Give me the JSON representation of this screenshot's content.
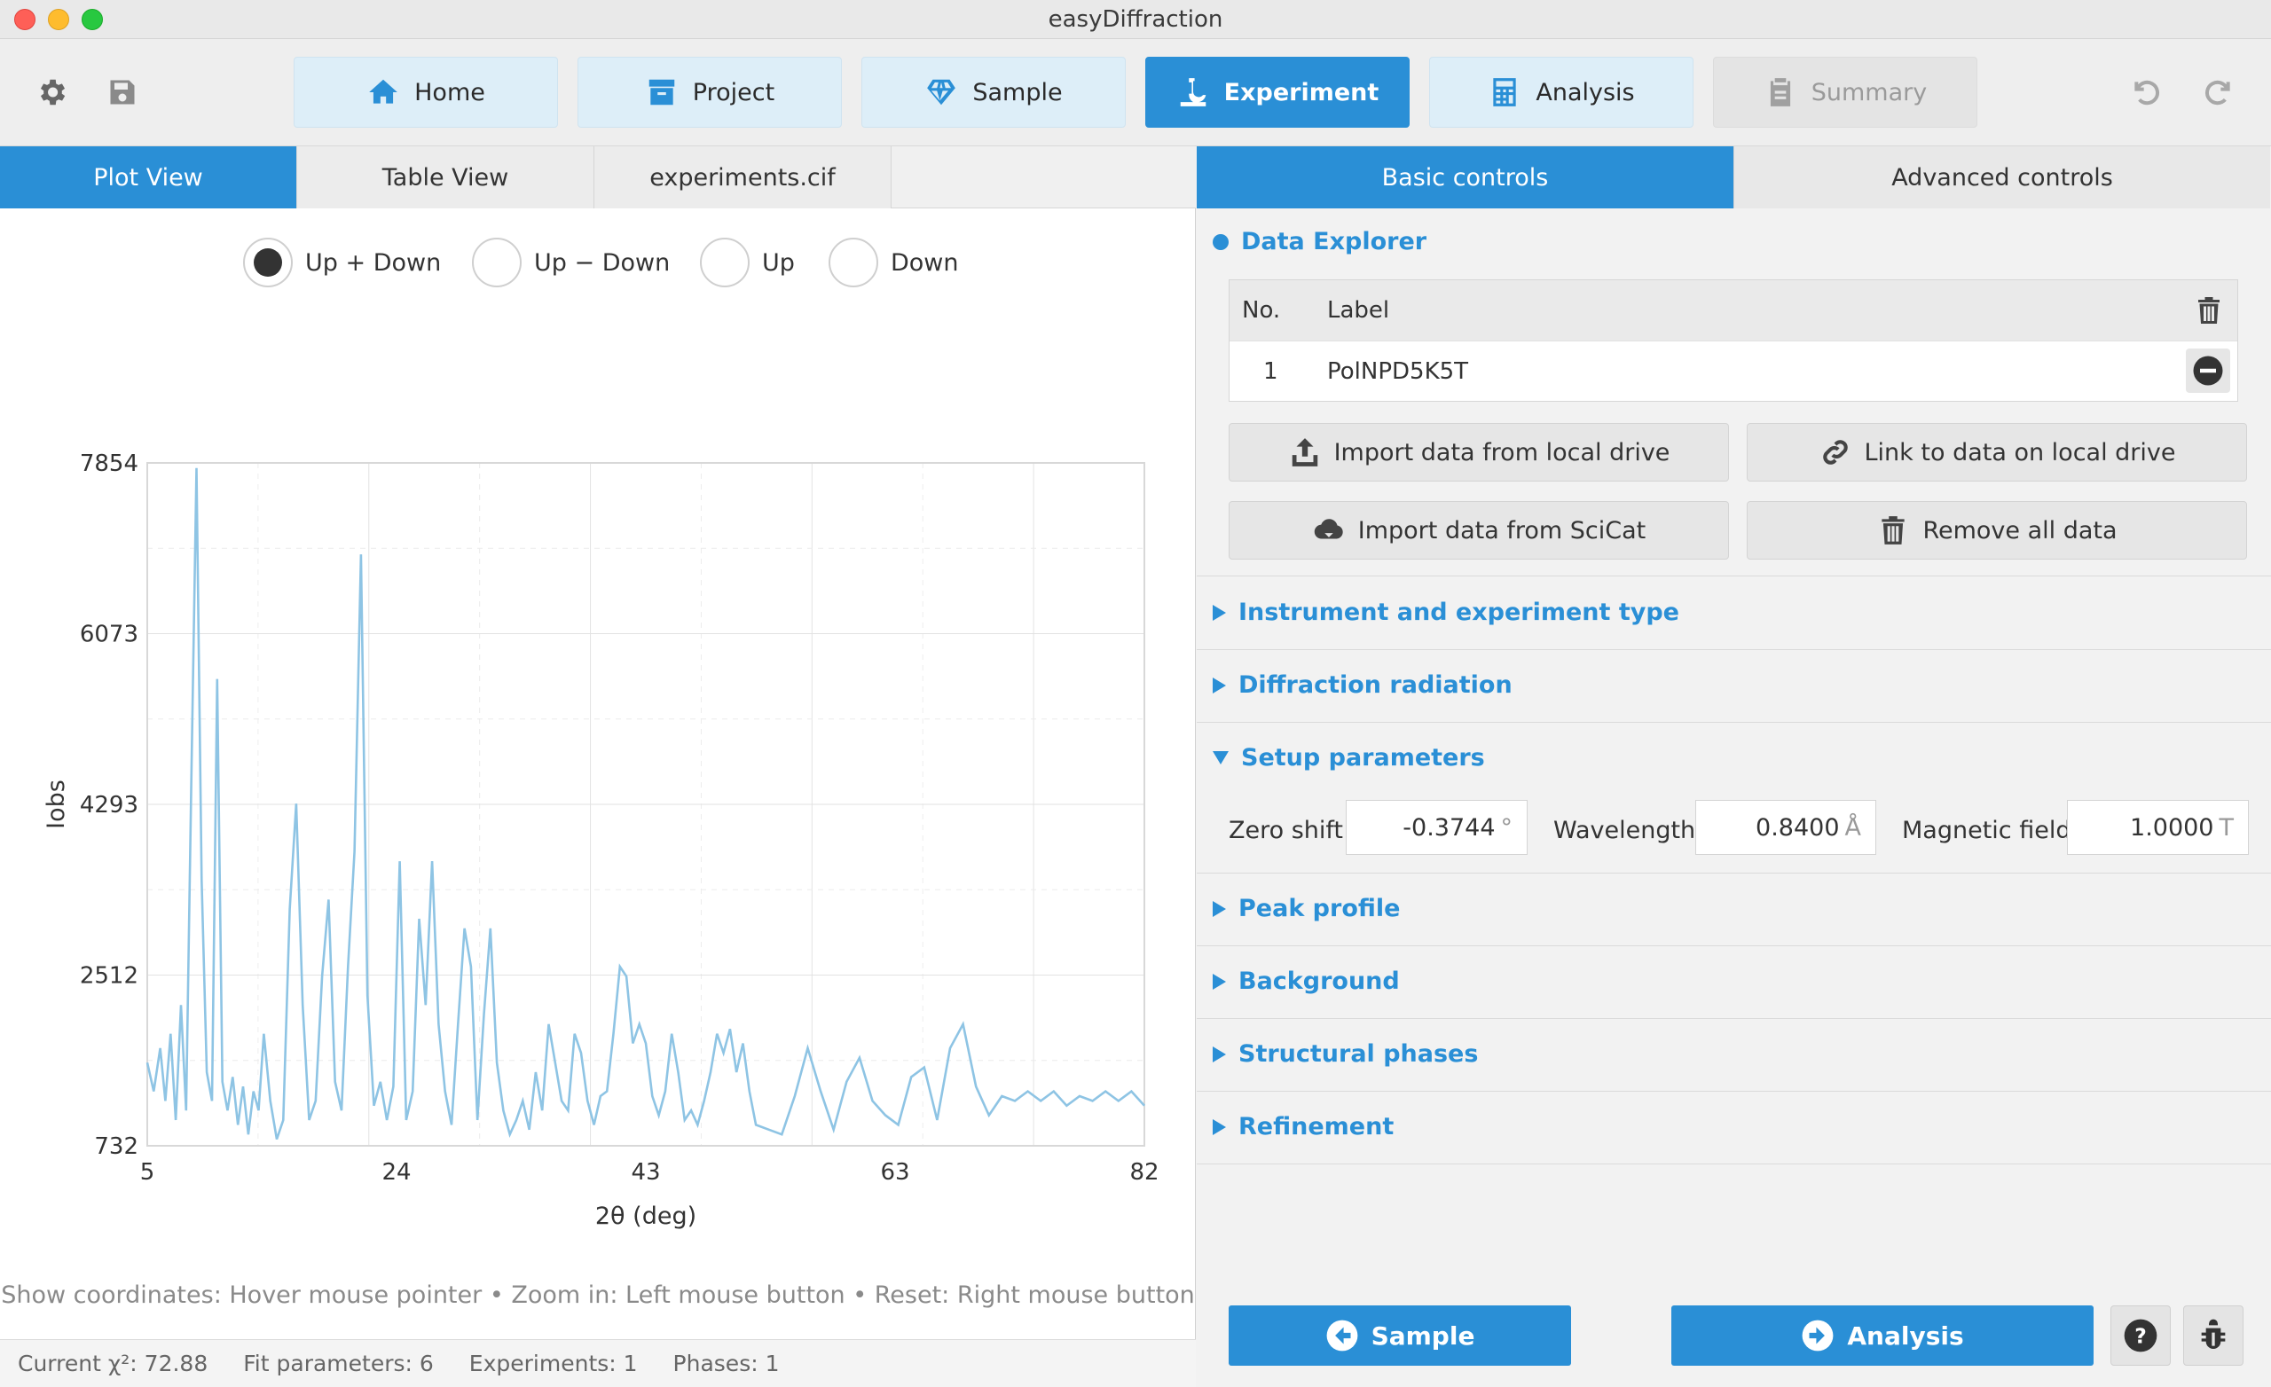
{
  "window": {
    "title": "easyDiffraction"
  },
  "toolbar": {
    "tabs": [
      {
        "label": "Home",
        "icon": "home-icon"
      },
      {
        "label": "Project",
        "icon": "archive-icon"
      },
      {
        "label": "Sample",
        "icon": "gem-icon"
      },
      {
        "label": "Experiment",
        "icon": "microscope-icon"
      },
      {
        "label": "Analysis",
        "icon": "calculator-icon"
      },
      {
        "label": "Summary",
        "icon": "clipboard-icon"
      }
    ],
    "active_tab": "Experiment"
  },
  "left": {
    "subtabs": [
      "Plot View",
      "Table View",
      "experiments.cif"
    ],
    "radios": [
      {
        "label": "Up + Down",
        "checked": true
      },
      {
        "label": "Up − Down",
        "checked": false
      },
      {
        "label": "Up",
        "checked": false
      },
      {
        "label": "Down",
        "checked": false
      }
    ],
    "hint": "Show coordinates: Hover mouse pointer  •  Zoom in: Left mouse button  •  Reset: Right mouse button",
    "status": {
      "chi": "Current χ²: 72.88",
      "fit": "Fit parameters: 6",
      "experiments": "Experiments: 1",
      "phases": "Phases: 1"
    }
  },
  "chart_data": {
    "type": "line",
    "title": "",
    "xlabel": "2θ (deg)",
    "ylabel": "Iobs",
    "xlim": [
      5,
      82
    ],
    "ylim": [
      732,
      7854
    ],
    "x_ticks": [
      "5",
      "24",
      "43",
      "63",
      "82"
    ],
    "y_ticks": [
      "7854",
      "6073",
      "4293",
      "2512",
      "732"
    ],
    "series": [
      {
        "color": "#8ec4e4",
        "x": [
          5.0,
          5.5,
          6.0,
          6.4,
          6.8,
          7.2,
          7.6,
          8.0,
          8.4,
          8.8,
          9.2,
          9.6,
          10.0,
          10.4,
          10.8,
          11.2,
          11.6,
          12.0,
          12.4,
          12.8,
          13.2,
          13.6,
          14.0,
          14.5,
          15.0,
          15.5,
          16.0,
          16.5,
          17.0,
          17.5,
          18.0,
          18.5,
          19.0,
          19.5,
          20.0,
          20.5,
          21.0,
          21.5,
          22.0,
          22.5,
          23.0,
          23.5,
          24.0,
          24.5,
          25.0,
          25.5,
          26.0,
          26.5,
          27.0,
          27.5,
          28.0,
          28.5,
          29.0,
          29.5,
          30.0,
          30.5,
          31.0,
          31.5,
          32.0,
          32.5,
          33.0,
          33.5,
          34.0,
          34.5,
          35.0,
          35.5,
          36.0,
          36.5,
          37.0,
          37.5,
          38.0,
          38.5,
          39.0,
          39.5,
          40.0,
          40.5,
          41.0,
          41.5,
          42.0,
          42.5,
          43.0,
          43.5,
          44.0,
          44.5,
          45.0,
          45.5,
          46.0,
          46.5,
          47.0,
          47.5,
          48.0,
          48.5,
          49.0,
          49.5,
          50.0,
          50.5,
          51.0,
          51.5,
          52.0,
          53.0,
          54.0,
          55.0,
          56.0,
          57.0,
          58.0,
          59.0,
          60.0,
          61.0,
          62.0,
          63.0,
          64.0,
          65.0,
          66.0,
          67.0,
          68.0,
          69.0,
          70.0,
          71.0,
          72.0,
          73.0,
          74.0,
          75.0,
          76.0,
          77.0,
          78.0,
          79.0,
          80.0,
          81.0,
          82.0
        ],
        "y": [
          1600,
          1300,
          1750,
          1200,
          1900,
          1000,
          2200,
          1100,
          4500,
          7800,
          3500,
          1500,
          1200,
          5600,
          1400,
          1100,
          1450,
          950,
          1350,
          850,
          1300,
          1100,
          1900,
          1200,
          800,
          1000,
          3200,
          4300,
          2200,
          1000,
          1200,
          2500,
          3300,
          1400,
          1100,
          2600,
          3800,
          6900,
          2300,
          1150,
          1400,
          1000,
          1350,
          3700,
          1000,
          1300,
          3100,
          2200,
          3700,
          2000,
          1300,
          950,
          2000,
          3000,
          2600,
          1000,
          2100,
          3000,
          1600,
          1100,
          850,
          1000,
          1200,
          900,
          1500,
          1100,
          2000,
          1600,
          1200,
          1100,
          1900,
          1700,
          1200,
          950,
          1250,
          1300,
          1900,
          2600,
          2500,
          1800,
          2000,
          1800,
          1250,
          1050,
          1300,
          1900,
          1500,
          1000,
          1100,
          950,
          1200,
          1500,
          1900,
          1700,
          1950,
          1500,
          1800,
          1300,
          950,
          900,
          850,
          1250,
          1750,
          1300,
          900,
          1400,
          1650,
          1200,
          1050,
          950,
          1450,
          1550,
          1000,
          1750,
          2000,
          1350,
          1050,
          1250,
          1200,
          1300,
          1200,
          1300,
          1150,
          1250,
          1200,
          1300,
          1200,
          1300,
          1150
        ]
      }
    ],
    "grid": true,
    "legend": "none"
  },
  "right": {
    "tabs": [
      "Basic controls",
      "Advanced controls"
    ],
    "data_explorer": {
      "title": "Data Explorer",
      "columns": [
        "No.",
        "Label"
      ],
      "rows": [
        {
          "no": "1",
          "label": "PolNPD5K5T"
        }
      ],
      "buttons": {
        "import_local": "Import data from local drive",
        "link_local": "Link to data on local drive",
        "import_scicat": "Import data from SciCat",
        "remove_all": "Remove all data"
      }
    },
    "sections": {
      "instrument": "Instrument and experiment type",
      "radiation": "Diffraction radiation",
      "setup": "Setup parameters",
      "peak": "Peak profile",
      "background": "Background",
      "phases": "Structural phases",
      "refinement": "Refinement"
    },
    "setup_params": {
      "zero_shift": {
        "label": "Zero shift:",
        "value": "-0.3744",
        "unit": "°"
      },
      "wavelength": {
        "label": "Wavelength:",
        "value": "0.8400",
        "unit": "Å"
      },
      "magnetic": {
        "label": "Magnetic field:",
        "value": "1.0000",
        "unit": "T"
      }
    },
    "nav": {
      "back": "Sample",
      "next": "Analysis"
    }
  },
  "colors": {
    "accent": "#2a8fd6",
    "tab_bg": "#ddeef8",
    "line": "#8ec4e4"
  }
}
